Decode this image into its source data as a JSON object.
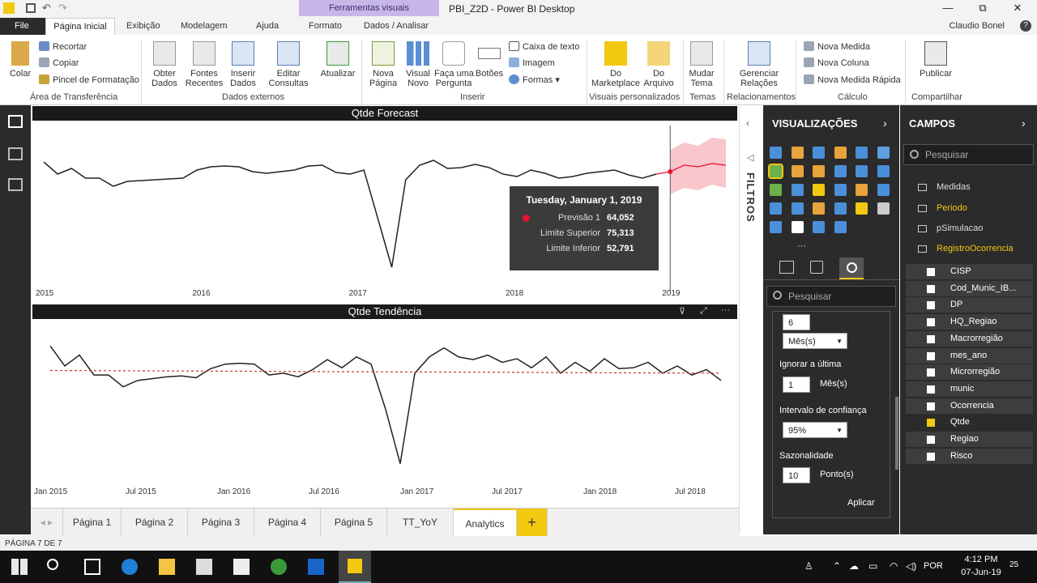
{
  "window": {
    "title": "PBI_Z2D - Power BI Desktop",
    "context_tab": "Ferramentas visuais",
    "user": "Claudio Bonel",
    "minimize": "—",
    "maximize": "⧉",
    "close": "✕"
  },
  "ribbon_tabs": {
    "file": "File",
    "home": "Página Inicial",
    "view": "Exibição",
    "modeling": "Modelagem",
    "help": "Ajuda",
    "format": "Formato",
    "data_analyze": "Dados / Analisar"
  },
  "ribbon": {
    "paste": "Colar",
    "cut": "Recortar",
    "copy": "Copiar",
    "format_painter": "Pincel de Formatação",
    "clipboard_group": "Área de Transferência",
    "get_data": "Obter\nDados",
    "recent_sources": "Fontes\nRecentes",
    "enter_data": "Inserir\nDados",
    "edit_queries": "Editar\nConsultas",
    "external_group": "Dados externos",
    "refresh": "Atualizar",
    "new_page": "Nova\nPágina",
    "new_visual": "Visual\nNovo",
    "ask_question": "Faça uma\nPergunta",
    "buttons": "Botões",
    "text_box": "Caixa de texto",
    "image": "Imagem",
    "shapes": "Formas",
    "insert_group": "Inserir",
    "from_marketplace": "Do\nMarketplace",
    "from_file": "Do\nArquivo",
    "custom_visuals_group": "Visuais personalizados",
    "switch_theme": "Mudar\nTema",
    "themes_group": "Temas",
    "manage_relationships": "Gerenciar\nRelações",
    "relationships_group": "Relacionamentos",
    "new_measure": "Nova Medida",
    "new_column": "Nova Coluna",
    "new_quick_measure": "Nova Medida Rápida",
    "calculations_group": "Cálculo",
    "publish": "Publicar",
    "share_group": "Compartilhar"
  },
  "chart_data": [
    {
      "type": "line",
      "title": "Qtde Forecast",
      "x_ticks": [
        "2015",
        "2016",
        "2017",
        "2018",
        "2019"
      ],
      "values": [
        190,
        175,
        182,
        170,
        170,
        160,
        166,
        167,
        168,
        169,
        170,
        180,
        184,
        185,
        184,
        178,
        176,
        178,
        180,
        185,
        186,
        177,
        175,
        180,
        120,
        60,
        168,
        186,
        192,
        182,
        183,
        187,
        183,
        175,
        172,
        180,
        176,
        170,
        172,
        176,
        178,
        180,
        174,
        170,
        175
      ],
      "forecast": {
        "values": [
          178,
          186,
          184,
          188,
          186
        ],
        "upper": [
          205,
          214,
          210,
          220,
          218
        ],
        "lower": [
          150,
          158,
          155,
          162,
          158
        ]
      },
      "tooltip": {
        "date": "Tuesday, January 1, 2019",
        "rows": [
          {
            "label": "Previsão 1",
            "value": "64,052"
          },
          {
            "label": "Limite Superior",
            "value": "75,313"
          },
          {
            "label": "Limite Inferior",
            "value": "52,791"
          }
        ]
      }
    },
    {
      "type": "line",
      "title": "Qtde Tendência",
      "x_ticks": [
        "Jan 2015",
        "Jul 2015",
        "Jan 2016",
        "Jul 2016",
        "Jan 2017",
        "Jul 2017",
        "Jan 2018",
        "Jul 2018"
      ],
      "values": [
        190,
        168,
        180,
        158,
        158,
        145,
        152,
        154,
        156,
        157,
        155,
        165,
        170,
        171,
        170,
        158,
        160,
        156,
        164,
        175,
        166,
        178,
        170,
        120,
        60,
        160,
        178,
        188,
        178,
        175,
        180,
        172,
        176,
        166,
        178,
        160,
        172,
        162,
        176,
        165,
        166,
        172,
        160,
        168,
        158,
        164,
        152
      ],
      "trend_line": [
        163,
        160
      ]
    }
  ],
  "page_tabs": [
    "Página 1",
    "Página 2",
    "Página 3",
    "Página 4",
    "Página 5",
    "TT_YoY",
    "Analytics"
  ],
  "active_page": "Analytics",
  "add_page": "+",
  "filters_label": "FILTROS",
  "viz_pane": {
    "title": "VISUALIZAÇÕES",
    "search_placeholder": "Pesquisar",
    "forecast_units_value": "6",
    "forecast_units_unit": "Mês(s)",
    "ignore_last_label": "Ignorar a última",
    "ignore_last_value": "1",
    "ignore_last_unit": "Mês(s)",
    "confidence_label": "Intervalo de confiança",
    "confidence_value": "95%",
    "seasonality_label": "Sazonalidade",
    "seasonality_value": "10",
    "seasonality_unit": "Ponto(s)",
    "apply": "Aplicar",
    "more": "···"
  },
  "fields_pane": {
    "title": "CAMPOS",
    "search_placeholder": "Pesquisar",
    "tables": [
      "Medidas",
      "Periodo",
      "pSimulacao",
      "RegistroOcorrencia"
    ],
    "fields": [
      "CISP",
      "Cod_Munic_IB...",
      "DP",
      "HQ_Regiao",
      "Macrorregião",
      "mes_ano",
      "Microrregião",
      "munic",
      "Ocorrencia",
      "Qtde",
      "Regiao",
      "Risco"
    ]
  },
  "status": "PÁGINA 7 DE 7",
  "taskbar": {
    "time": "4:12 PM",
    "date": "07-Jun-19",
    "lang": "POR",
    "notifications": "25"
  }
}
